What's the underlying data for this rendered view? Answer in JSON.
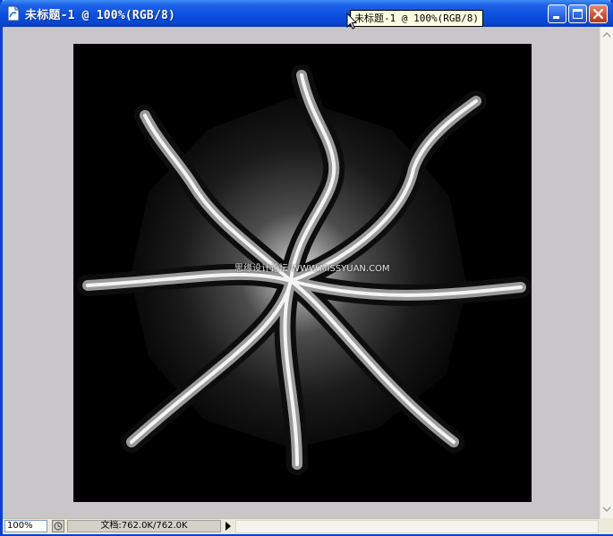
{
  "window": {
    "title": "未标题-1 @ 100%(RGB/8)",
    "tooltip": "未标题-1 @ 100%(RGB/8)",
    "minimize_icon": "minimize-icon",
    "maximize_icon": "maximize-icon",
    "close_icon": "close-icon"
  },
  "canvas": {
    "background": "#000000",
    "watermark": "思缘设计论坛 WWW.MISSYUAN.COM"
  },
  "statusbar": {
    "zoom": "100%",
    "doc_info": "文档:762.0K/762.0K"
  },
  "colors": {
    "titlebar": "#0b4fe0",
    "close_button": "#d2552f",
    "workspace": "#c8c6c8"
  }
}
